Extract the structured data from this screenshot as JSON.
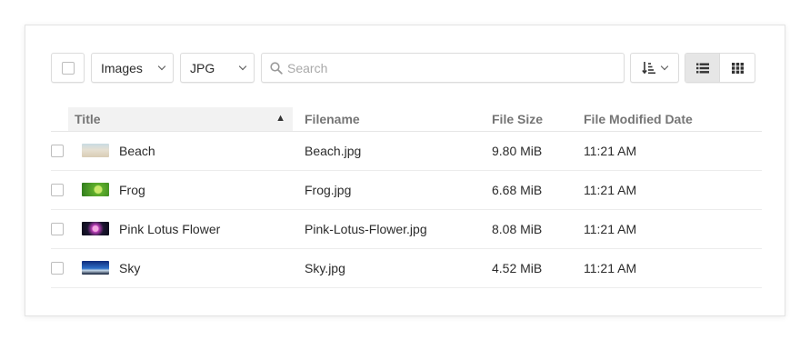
{
  "toolbar": {
    "type_filter": "Images",
    "extension_filter": "JPG",
    "search_placeholder": "Search"
  },
  "columns": {
    "title": "Title",
    "filename": "Filename",
    "file_size": "File Size",
    "modified": "File Modified Date",
    "sort_indicator": "▲"
  },
  "rows": [
    {
      "title": "Beach",
      "filename": "Beach.jpg",
      "size": "9.80 MiB",
      "modified": "11:21 AM",
      "thumb": "beach"
    },
    {
      "title": "Frog",
      "filename": "Frog.jpg",
      "size": "6.68 MiB",
      "modified": "11:21 AM",
      "thumb": "frog"
    },
    {
      "title": "Pink Lotus Flower",
      "filename": "Pink-Lotus-Flower.jpg",
      "size": "8.08 MiB",
      "modified": "11:21 AM",
      "thumb": "lotus"
    },
    {
      "title": "Sky",
      "filename": "Sky.jpg",
      "size": "4.52 MiB",
      "modified": "11:21 AM",
      "thumb": "sky"
    }
  ],
  "icons": {
    "search": "search-icon",
    "sort": "sort-order-icon",
    "list_view": "list-view-icon",
    "grid_view": "grid-view-icon"
  },
  "colors": {
    "border": "#dcdcdc",
    "header_bg": "#f2f2f2",
    "active_view_bg": "#e6e6e6",
    "muted_text": "#757575"
  }
}
